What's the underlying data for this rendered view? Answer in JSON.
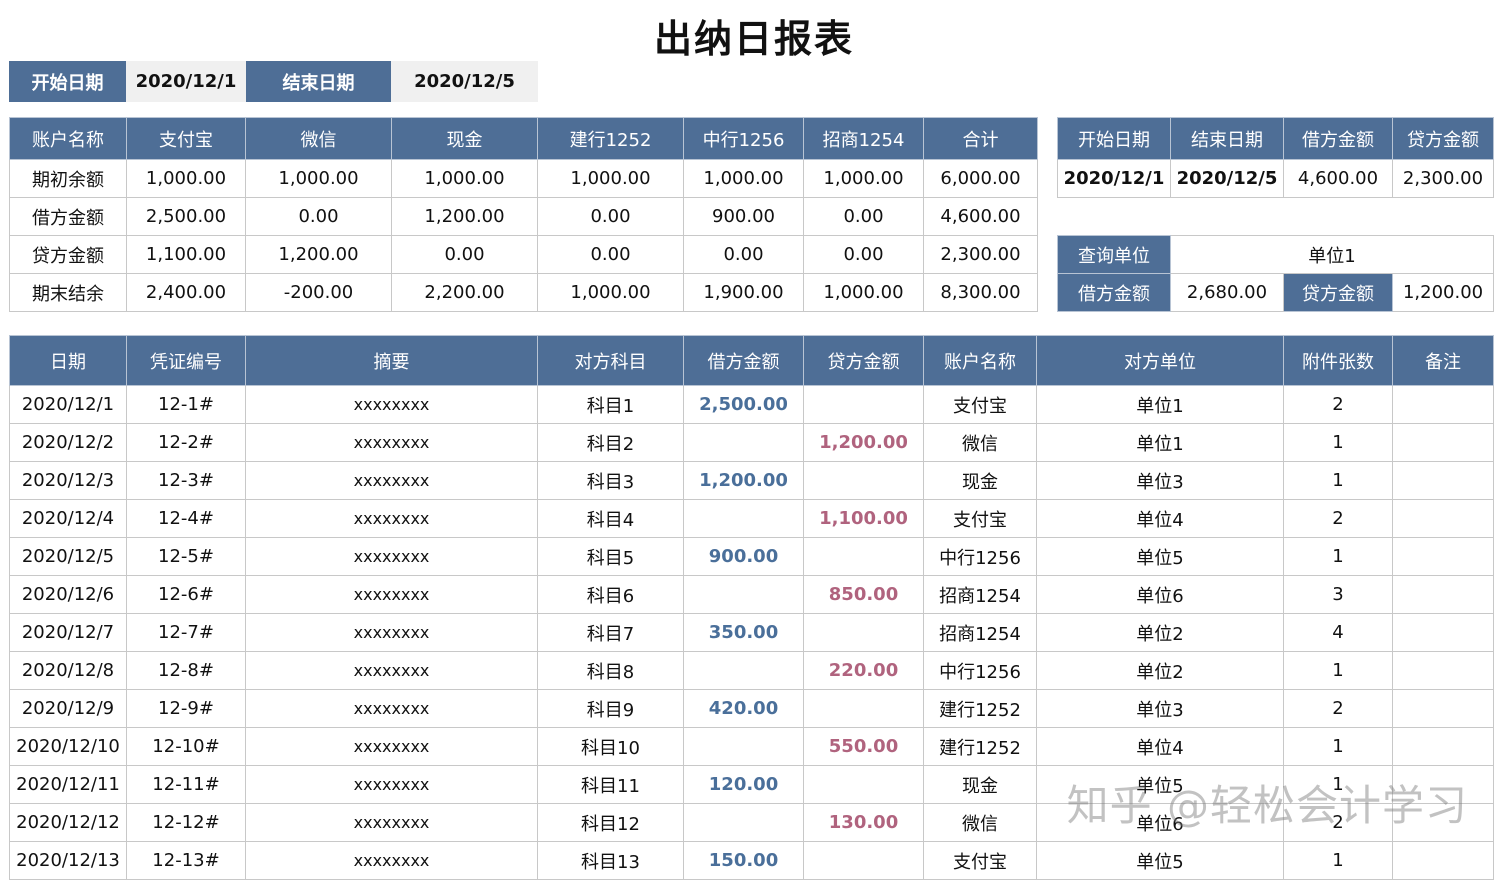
{
  "title": "出纳日报表",
  "date_range": {
    "start_label": "开始日期",
    "start_value": "2020/12/1",
    "end_label": "结束日期",
    "end_value": "2020/12/5"
  },
  "balance_table": {
    "headers": [
      "账户名称",
      "支付宝",
      "微信",
      "现金",
      "建行1252",
      "中行1256",
      "招商1254",
      "合计"
    ],
    "rows": [
      [
        "期初余额",
        "1,000.00",
        "1,000.00",
        "1,000.00",
        "1,000.00",
        "1,000.00",
        "1,000.00",
        "6,000.00"
      ],
      [
        "借方金额",
        "2,500.00",
        "0.00",
        "1,200.00",
        "0.00",
        "900.00",
        "0.00",
        "4,600.00"
      ],
      [
        "贷方金额",
        "1,100.00",
        "1,200.00",
        "0.00",
        "0.00",
        "0.00",
        "0.00",
        "2,300.00"
      ],
      [
        "期末结余",
        "2,400.00",
        "-200.00",
        "2,200.00",
        "1,000.00",
        "1,900.00",
        "1,000.00",
        "8,300.00"
      ]
    ]
  },
  "summary_table": {
    "headers": [
      "开始日期",
      "结束日期",
      "借方金额",
      "贷方金额"
    ],
    "values": [
      "2020/12/1",
      "2020/12/5",
      "4,600.00",
      "2,300.00"
    ]
  },
  "query_table": {
    "unit_label": "查询单位",
    "unit_value": "单位1",
    "debit_label": "借方金额",
    "debit_value": "2,680.00",
    "credit_label": "贷方金额",
    "credit_value": "1,200.00"
  },
  "journal": {
    "headers": [
      "日期",
      "凭证编号",
      "摘要",
      "对方科目",
      "借方金额",
      "贷方金额",
      "账户名称",
      "对方单位",
      "附件张数",
      "备注"
    ],
    "rows": [
      [
        "2020/12/1",
        "12-1#",
        "xxxxxxxx",
        "科目1",
        "2,500.00",
        "",
        "支付宝",
        "单位1",
        "2",
        ""
      ],
      [
        "2020/12/2",
        "12-2#",
        "xxxxxxxx",
        "科目2",
        "",
        "1,200.00",
        "微信",
        "单位1",
        "1",
        ""
      ],
      [
        "2020/12/3",
        "12-3#",
        "xxxxxxxx",
        "科目3",
        "1,200.00",
        "",
        "现金",
        "单位3",
        "1",
        ""
      ],
      [
        "2020/12/4",
        "12-4#",
        "xxxxxxxx",
        "科目4",
        "",
        "1,100.00",
        "支付宝",
        "单位4",
        "2",
        ""
      ],
      [
        "2020/12/5",
        "12-5#",
        "xxxxxxxx",
        "科目5",
        "900.00",
        "",
        "中行1256",
        "单位5",
        "1",
        ""
      ],
      [
        "2020/12/6",
        "12-6#",
        "xxxxxxxx",
        "科目6",
        "",
        "850.00",
        "招商1254",
        "单位6",
        "3",
        ""
      ],
      [
        "2020/12/7",
        "12-7#",
        "xxxxxxxx",
        "科目7",
        "350.00",
        "",
        "招商1254",
        "单位2",
        "4",
        ""
      ],
      [
        "2020/12/8",
        "12-8#",
        "xxxxxxxx",
        "科目8",
        "",
        "220.00",
        "中行1256",
        "单位2",
        "1",
        ""
      ],
      [
        "2020/12/9",
        "12-9#",
        "xxxxxxxx",
        "科目9",
        "420.00",
        "",
        "建行1252",
        "单位3",
        "2",
        ""
      ],
      [
        "2020/12/10",
        "12-10#",
        "xxxxxxxx",
        "科目10",
        "",
        "550.00",
        "建行1252",
        "单位4",
        "1",
        ""
      ],
      [
        "2020/12/11",
        "12-11#",
        "xxxxxxxx",
        "科目11",
        "120.00",
        "",
        "现金",
        "单位5",
        "1",
        ""
      ],
      [
        "2020/12/12",
        "12-12#",
        "xxxxxxxx",
        "科目12",
        "",
        "130.00",
        "微信",
        "单位6",
        "2",
        ""
      ],
      [
        "2020/12/13",
        "12-13#",
        "xxxxxxxx",
        "科目13",
        "150.00",
        "",
        "支付宝",
        "单位5",
        "1",
        ""
      ]
    ]
  },
  "watermark": "知乎 @轻松会计学习",
  "colors": {
    "header_bg": "#4e6e96",
    "debit_text": "#4a6f9a",
    "credit_text": "#b0637e"
  }
}
